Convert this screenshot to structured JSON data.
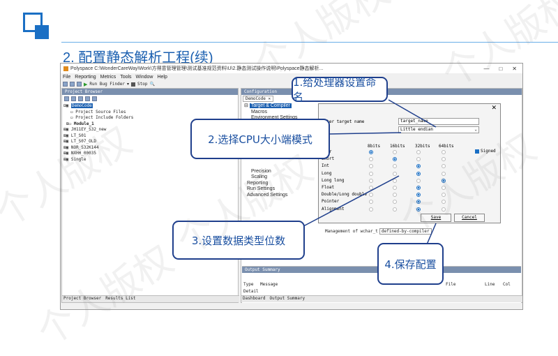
{
  "slide": {
    "title": "2. 配置静态解析工程(续)",
    "watermark": "个人版权"
  },
  "window": {
    "title": "Polyspace C:\\WonderCareWay\\Work\\方得意管理管理\\测试基准规范资料\\U\\2.静态测试操作说明\\Polyspace静态解析...",
    "controls": [
      "—",
      "□",
      "✕"
    ]
  },
  "menu": [
    "File",
    "Reporting",
    "Metrics",
    "Tools",
    "Window",
    "Help"
  ],
  "toolbar": {
    "run_label": "Run Bug Finder",
    "stop_label": "Stop"
  },
  "project_browser": {
    "header": "Project Browser",
    "items": [
      {
        "label": "DemoCode",
        "selected": true,
        "indent": 0
      },
      {
        "label": "Project Source Files",
        "indent": 1
      },
      {
        "label": "Project Include Folders",
        "indent": 1
      },
      {
        "label": "Module_1",
        "indent": 1
      },
      {
        "label": "JH11EY_S32_new",
        "indent": 0
      },
      {
        "label": "LT_S01",
        "indent": 0
      },
      {
        "label": "LT_S07_OLD",
        "indent": 0
      },
      {
        "label": "NOR_S32K144",
        "indent": 0
      },
      {
        "label": "NXHH_00035",
        "indent": 0
      },
      {
        "label": "Single",
        "indent": 0
      }
    ],
    "tabs": [
      "Project Browser",
      "Results List"
    ]
  },
  "configuration": {
    "header": "Configuration",
    "tab": "DemoCode",
    "tree": [
      {
        "label": "Target & Compiler",
        "selected": true
      },
      {
        "label": "Macros"
      },
      {
        "label": "Environment Settings"
      },
      {
        "label": "Precision"
      },
      {
        "label": "Scaling"
      },
      {
        "label": "Reporting"
      },
      {
        "label": "Run Settings"
      },
      {
        "label": "Advanced Settings"
      }
    ],
    "mgmt_label": "Management of wchar_t",
    "mgmt_value": "defined-by-compiler"
  },
  "output_summary": {
    "header": "Output Summary",
    "columns": [
      "Type",
      "Message",
      "File",
      "Line",
      "Col"
    ],
    "row": "Detail",
    "tabs": [
      "Dashboard",
      "Output Summary"
    ]
  },
  "dialog": {
    "close": "✕",
    "target_label": "Enter target name",
    "target_value": "target_name",
    "endian_value": "Little endian",
    "columns": [
      "8bits",
      "16bits",
      "32bits",
      "64bits"
    ],
    "signed_label": "Signed",
    "rows": [
      {
        "label": "Char",
        "selected": 0
      },
      {
        "label": "Short",
        "selected": 1
      },
      {
        "label": "Int",
        "selected": 2
      },
      {
        "label": "Long",
        "selected": 2
      },
      {
        "label": "Long long",
        "selected": 3
      },
      {
        "label": "Float",
        "selected": 2
      },
      {
        "label": "Double/Long double",
        "selected": 2
      },
      {
        "label": "Pointer",
        "selected": 2
      },
      {
        "label": "Alignment",
        "selected": 2
      }
    ],
    "save_label": "Save",
    "cancel_label": "Cancel"
  },
  "callouts": [
    {
      "id": "c1",
      "text": "1.给处理器设置命名"
    },
    {
      "id": "c2",
      "text": "2.选择CPU大小端模式"
    },
    {
      "id": "c3",
      "text": "3.设置数据类型位数"
    },
    {
      "id": "c4",
      "text": "4.保存配置"
    }
  ],
  "colors": {
    "accent": "#1a6fc4",
    "title": "#1a5fb0",
    "callout_border": "#1f3f8c"
  }
}
